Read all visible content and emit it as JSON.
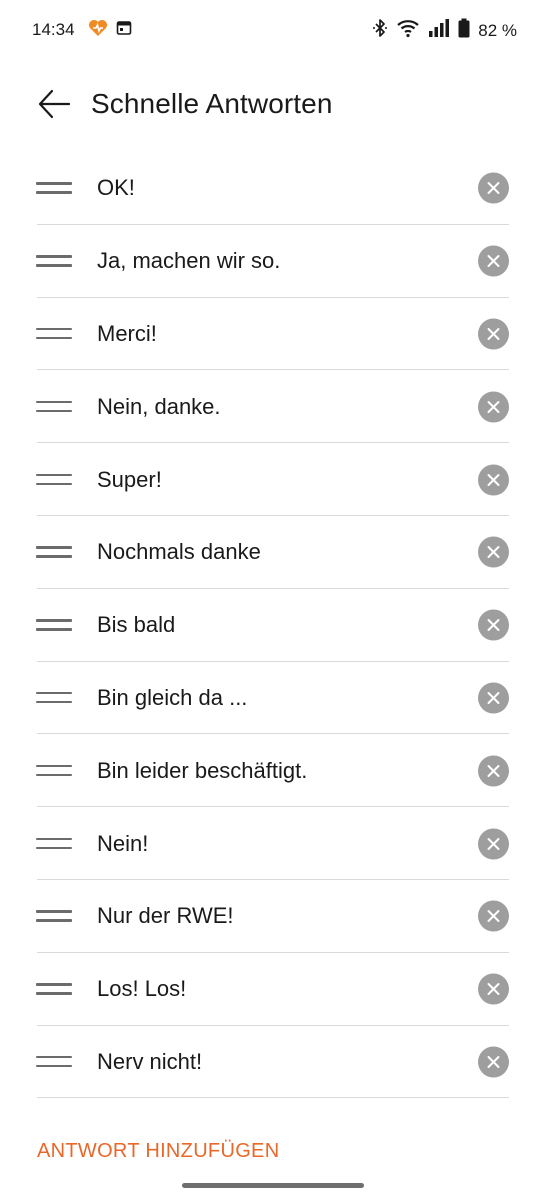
{
  "status_bar": {
    "time": "14:34",
    "battery": "82 %",
    "left_icons": [
      "health-icon",
      "calendar-icon"
    ],
    "right_icons": [
      "bluetooth-icon",
      "wifi-icon",
      "signal-icon",
      "battery-icon"
    ],
    "accent_color": "#f08a24"
  },
  "header": {
    "title": "Schnelle Antworten",
    "back_icon": "arrow-left-icon"
  },
  "replies": [
    "OK!",
    "Ja, machen wir so.",
    "Merci!",
    "Nein, danke.",
    "Super!",
    "Nochmals danke",
    "Bis bald",
    "Bin gleich da ...",
    "Bin leider beschäftigt.",
    "Nein!",
    "Nur der RWE!",
    "Los! Los!",
    "Nerv nicht!"
  ],
  "add_label": "ANTWORT HINZUFÜGEN",
  "colors": {
    "accent": "#e8682a",
    "delete_icon_bg": "#9e9e9e",
    "divider": "#d9d9d9"
  }
}
